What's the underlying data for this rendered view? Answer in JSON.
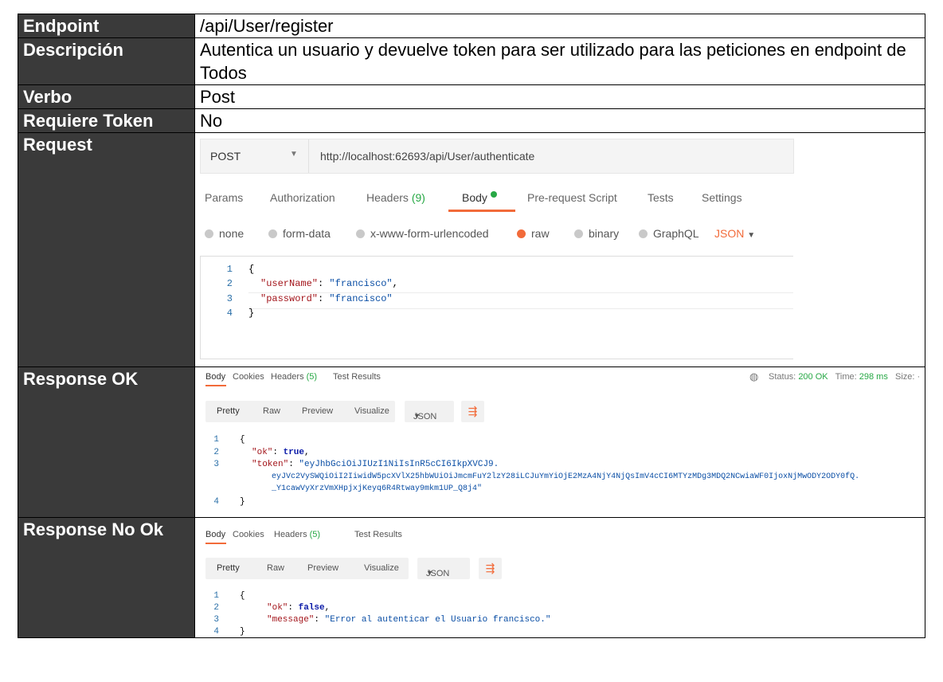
{
  "rows": {
    "endpoint": {
      "label": "Endpoint",
      "value": "/api/User/register"
    },
    "descripcion": {
      "label": "Descripción",
      "value": "Autentica un usuario y devuelve token para ser utilizado para las peticiones en endpoint de Todos"
    },
    "verbo": {
      "label": "Verbo",
      "value": "Post"
    },
    "token": {
      "label": "Requiere Token",
      "value": "No"
    },
    "request": {
      "label": "Request"
    },
    "response_ok": {
      "label": "Response OK"
    },
    "response_no_ok": {
      "label": "Response No Ok"
    }
  },
  "request": {
    "method": "POST",
    "url": "http://localhost:62693/api/User/authenticate",
    "tabs": [
      "Params",
      "Authorization",
      "Headers",
      "(9)",
      "Body",
      "Pre-request Script",
      "Tests",
      "Settings"
    ],
    "body_types": [
      "none",
      "form-data",
      "x-www-form-urlencoded",
      "raw",
      "binary",
      "GraphQL"
    ],
    "format": "JSON",
    "lines": [
      "1",
      "2",
      "3",
      "4"
    ],
    "code": {
      "open": "{",
      "k1": "\"userName\"",
      "v1": "\"francisco\"",
      "k2": "\"password\"",
      "v2": "\"francisco\"",
      "close": "}"
    }
  },
  "response_ok": {
    "tabs": [
      "Body",
      "Cookies",
      "Headers",
      "(5)",
      "Test Results"
    ],
    "status_label": "Status:",
    "status": "200 OK",
    "time_label": "Time:",
    "time": "298 ms",
    "size_label": "Size: ·",
    "views": [
      "Pretty",
      "Raw",
      "Preview",
      "Visualize",
      "JSON"
    ],
    "lines": [
      "1",
      "2",
      "3",
      "4"
    ],
    "code": {
      "open": "{",
      "k_ok": "\"ok\"",
      "v_ok": "true",
      "k_token": "\"token\"",
      "token1": "\"eyJhbGciOiJIUzI1NiIsInR5cCI6IkpXVCJ9.",
      "token2": "eyJVc2VySWQiOiI2IiwidW5pcXVlX25hbWUiOiJmcmFuY2lzY28iLCJuYmYiOjE2MzA4NjY4NjQsImV4cCI6MTYzMDg3MDQ2NCwiaWF0IjoxNjMwODY2ODY0fQ.",
      "token3": "_Y1cawVyXrzVmXHpjxjKeyq6R4Rtway9mkm1UP_Q8j4\"",
      "close": "}"
    }
  },
  "response_no_ok": {
    "tabs": [
      "Body",
      "Cookies",
      "Headers",
      "(5)",
      "Test Results"
    ],
    "views": [
      "Pretty",
      "Raw",
      "Preview",
      "Visualize",
      "JSON"
    ],
    "lines": [
      "1",
      "2",
      "3",
      "4"
    ],
    "code": {
      "open": "{",
      "k_ok": "\"ok\"",
      "v_ok": "false",
      "k_msg": "\"message\"",
      "v_msg": "\"Error al autenticar el Usuario francisco.\"",
      "close": "}"
    }
  }
}
